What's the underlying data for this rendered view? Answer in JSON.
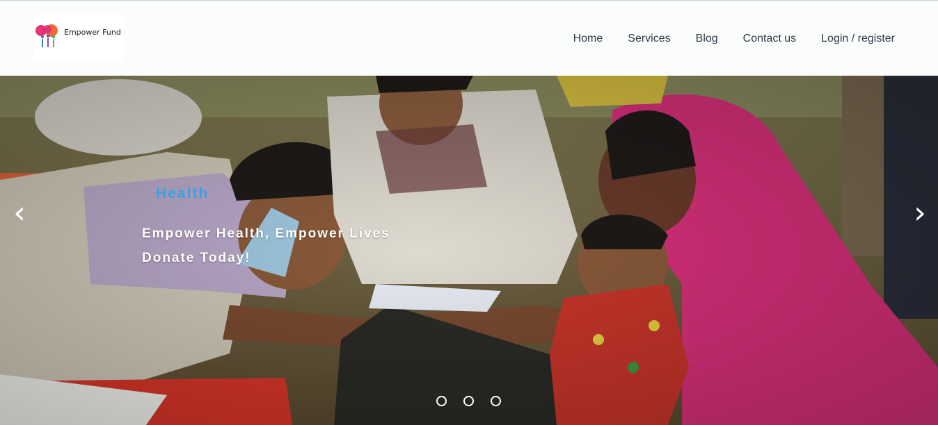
{
  "brand": {
    "name": "Empower Fund",
    "colors": {
      "heart_pink": "#e8357a",
      "heart_orange": "#f06a3a",
      "people_blue": "#3a7fd0",
      "people_green": "#3cb371"
    }
  },
  "nav": {
    "items": [
      {
        "label": "Home"
      },
      {
        "label": "Services"
      },
      {
        "label": "Blog"
      },
      {
        "label": "Contact us"
      },
      {
        "label": "Login / register"
      }
    ]
  },
  "hero": {
    "category": "Health",
    "caption_line1": "Empower Health, Empower Lives",
    "caption_line2": "Donate Today!",
    "prev_icon": "‹",
    "next_icon": "›",
    "slide_count": 3,
    "accent_color": "#3aa0e6"
  }
}
